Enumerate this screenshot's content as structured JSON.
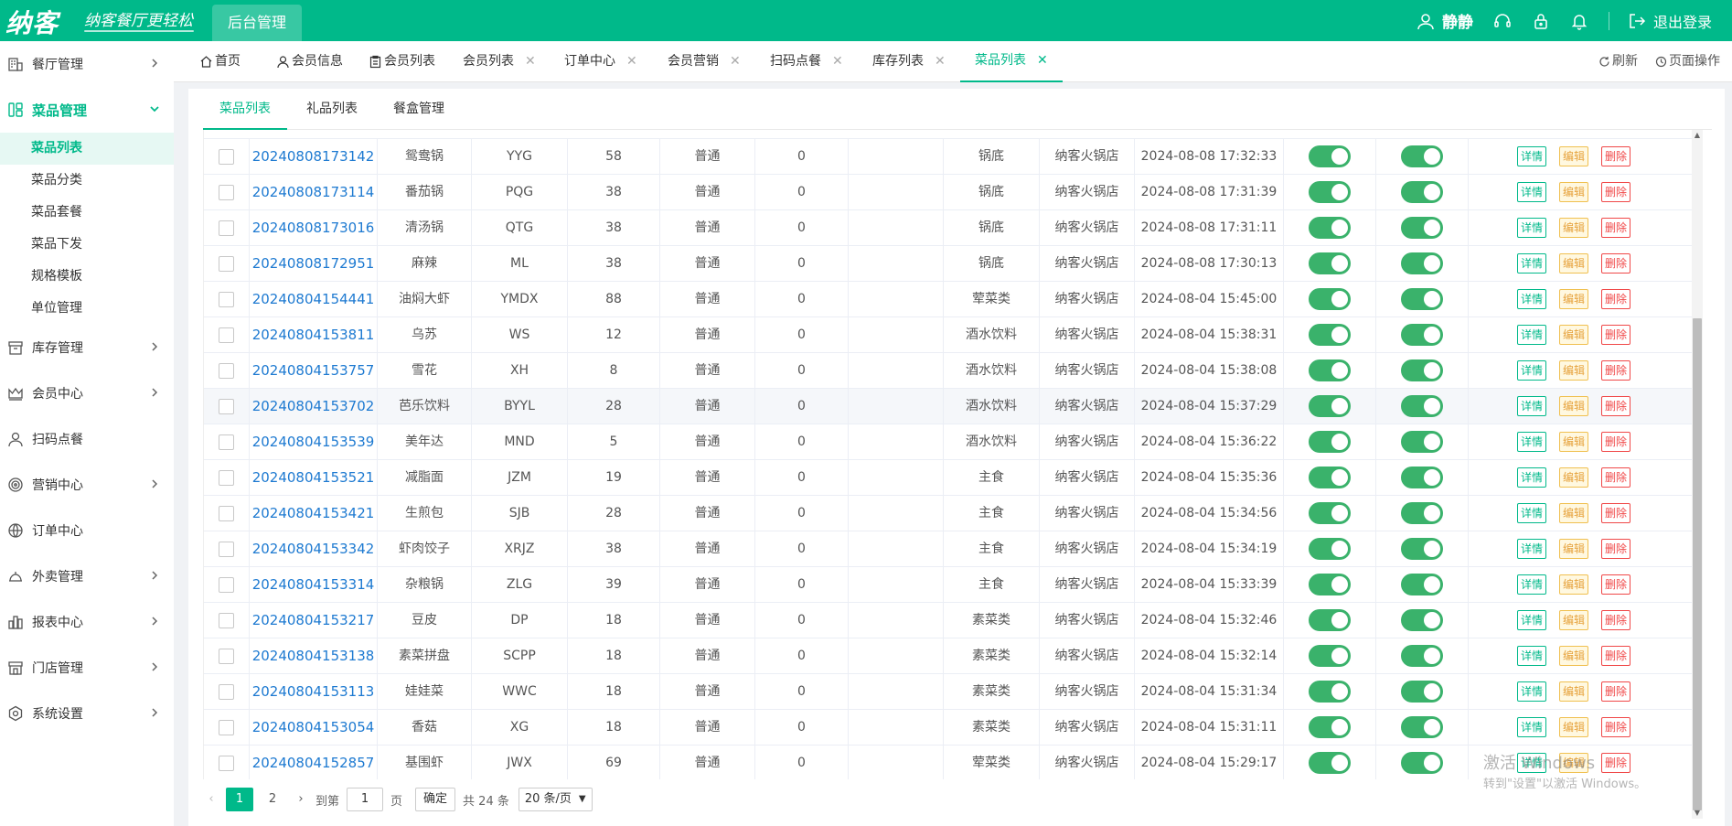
{
  "header": {
    "logo": "纳客",
    "slogan": "纳客餐厅更轻松",
    "admin_tab": "后台管理",
    "user": "静静",
    "logout": "退出登录"
  },
  "sidebar": {
    "items": [
      {
        "label": "餐厅管理",
        "icon": "store-icon"
      },
      {
        "label": "菜品管理",
        "icon": "dishes-icon"
      },
      {
        "label": "库存管理",
        "icon": "inventory-icon"
      },
      {
        "label": "会员中心",
        "icon": "crown-icon"
      },
      {
        "label": "扫码点餐",
        "icon": "person-icon"
      },
      {
        "label": "营销中心",
        "icon": "target-icon"
      },
      {
        "label": "订单中心",
        "icon": "globe-icon"
      },
      {
        "label": "外卖管理",
        "icon": "delivery-icon"
      },
      {
        "label": "报表中心",
        "icon": "report-icon"
      },
      {
        "label": "门店管理",
        "icon": "shop-icon"
      },
      {
        "label": "系统设置",
        "icon": "settings-icon"
      }
    ],
    "sub_items": [
      "菜品列表",
      "菜品分类",
      "菜品套餐",
      "菜品下发",
      "规格模板",
      "单位管理"
    ]
  },
  "tabs": [
    {
      "label": "首页"
    },
    {
      "label": "会员信息"
    },
    {
      "label": "会员列表"
    },
    {
      "label": "会员列表"
    },
    {
      "label": "订单中心"
    },
    {
      "label": "会员营销"
    },
    {
      "label": "扫码点餐"
    },
    {
      "label": "库存列表"
    },
    {
      "label": "菜品列表"
    }
  ],
  "tab_actions": {
    "refresh": "刷新",
    "page_ops": "页面操作"
  },
  "subtabs": [
    "菜品列表",
    "礼品列表",
    "餐盒管理"
  ],
  "rows": [
    {
      "code": "20240808173142",
      "name": "鸳鸯锅",
      "abbr": "YYG",
      "price": "58",
      "type": "普通",
      "qty": "0",
      "extra": "",
      "category": "锅底",
      "store": "纳客火锅店",
      "time": "2024-08-08 17:32:33"
    },
    {
      "code": "20240808173114",
      "name": "番茄锅",
      "abbr": "PQG",
      "price": "38",
      "type": "普通",
      "qty": "0",
      "extra": "",
      "category": "锅底",
      "store": "纳客火锅店",
      "time": "2024-08-08 17:31:39"
    },
    {
      "code": "20240808173016",
      "name": "清汤锅",
      "abbr": "QTG",
      "price": "38",
      "type": "普通",
      "qty": "0",
      "extra": "",
      "category": "锅底",
      "store": "纳客火锅店",
      "time": "2024-08-08 17:31:11"
    },
    {
      "code": "20240808172951",
      "name": "麻辣",
      "abbr": "ML",
      "price": "38",
      "type": "普通",
      "qty": "0",
      "extra": "",
      "category": "锅底",
      "store": "纳客火锅店",
      "time": "2024-08-08 17:30:13"
    },
    {
      "code": "20240804154441",
      "name": "油焖大虾",
      "abbr": "YMDX",
      "price": "88",
      "type": "普通",
      "qty": "0",
      "extra": "",
      "category": "荤菜类",
      "store": "纳客火锅店",
      "time": "2024-08-04 15:45:00"
    },
    {
      "code": "20240804153811",
      "name": "乌苏",
      "abbr": "WS",
      "price": "12",
      "type": "普通",
      "qty": "0",
      "extra": "",
      "category": "酒水饮料",
      "store": "纳客火锅店",
      "time": "2024-08-04 15:38:31"
    },
    {
      "code": "20240804153757",
      "name": "雪花",
      "abbr": "XH",
      "price": "8",
      "type": "普通",
      "qty": "0",
      "extra": "",
      "category": "酒水饮料",
      "store": "纳客火锅店",
      "time": "2024-08-04 15:38:08"
    },
    {
      "code": "20240804153702",
      "name": "芭乐饮料",
      "abbr": "BYYL",
      "price": "28",
      "type": "普通",
      "qty": "0",
      "extra": "",
      "category": "酒水饮料",
      "store": "纳客火锅店",
      "time": "2024-08-04 15:37:29"
    },
    {
      "code": "20240804153539",
      "name": "美年达",
      "abbr": "MND",
      "price": "5",
      "type": "普通",
      "qty": "0",
      "extra": "",
      "category": "酒水饮料",
      "store": "纳客火锅店",
      "time": "2024-08-04 15:36:22"
    },
    {
      "code": "20240804153521",
      "name": "减脂面",
      "abbr": "JZM",
      "price": "19",
      "type": "普通",
      "qty": "0",
      "extra": "",
      "category": "主食",
      "store": "纳客火锅店",
      "time": "2024-08-04 15:35:36"
    },
    {
      "code": "20240804153421",
      "name": "生煎包",
      "abbr": "SJB",
      "price": "28",
      "type": "普通",
      "qty": "0",
      "extra": "",
      "category": "主食",
      "store": "纳客火锅店",
      "time": "2024-08-04 15:34:56"
    },
    {
      "code": "20240804153342",
      "name": "虾肉饺子",
      "abbr": "XRJZ",
      "price": "38",
      "type": "普通",
      "qty": "0",
      "extra": "",
      "category": "主食",
      "store": "纳客火锅店",
      "time": "2024-08-04 15:34:19"
    },
    {
      "code": "20240804153314",
      "name": "杂粮锅",
      "abbr": "ZLG",
      "price": "39",
      "type": "普通",
      "qty": "0",
      "extra": "",
      "category": "主食",
      "store": "纳客火锅店",
      "time": "2024-08-04 15:33:39"
    },
    {
      "code": "20240804153217",
      "name": "豆皮",
      "abbr": "DP",
      "price": "18",
      "type": "普通",
      "qty": "0",
      "extra": "",
      "category": "素菜类",
      "store": "纳客火锅店",
      "time": "2024-08-04 15:32:46"
    },
    {
      "code": "20240804153138",
      "name": "素菜拼盘",
      "abbr": "SCPP",
      "price": "18",
      "type": "普通",
      "qty": "0",
      "extra": "",
      "category": "素菜类",
      "store": "纳客火锅店",
      "time": "2024-08-04 15:32:14"
    },
    {
      "code": "20240804153113",
      "name": "娃娃菜",
      "abbr": "WWC",
      "price": "18",
      "type": "普通",
      "qty": "0",
      "extra": "",
      "category": "素菜类",
      "store": "纳客火锅店",
      "time": "2024-08-04 15:31:34"
    },
    {
      "code": "20240804153054",
      "name": "香菇",
      "abbr": "XG",
      "price": "18",
      "type": "普通",
      "qty": "0",
      "extra": "",
      "category": "素菜类",
      "store": "纳客火锅店",
      "time": "2024-08-04 15:31:11"
    },
    {
      "code": "20240804152857",
      "name": "基围虾",
      "abbr": "JWX",
      "price": "69",
      "type": "普通",
      "qty": "0",
      "extra": "",
      "category": "荤菜类",
      "store": "纳客火锅店",
      "time": "2024-08-04 15:29:17"
    }
  ],
  "actions": {
    "detail": "详情",
    "edit": "编辑",
    "delete": "删除"
  },
  "pagination": {
    "pages": [
      "1",
      "2"
    ],
    "goto_label": "到第",
    "goto_value": "1",
    "page_unit": "页",
    "confirm": "确定",
    "total": "共 24 条",
    "page_size": "20 条/页"
  },
  "watermark": {
    "line1": "激活 Windows",
    "line2": "转到\"设置\"以激活 Windows。"
  },
  "colors": {
    "brand": "#00b98a",
    "switch_on": "#3ab26b",
    "link": "#1e7ad1",
    "danger": "#f04848",
    "warning": "#e6a23c"
  }
}
